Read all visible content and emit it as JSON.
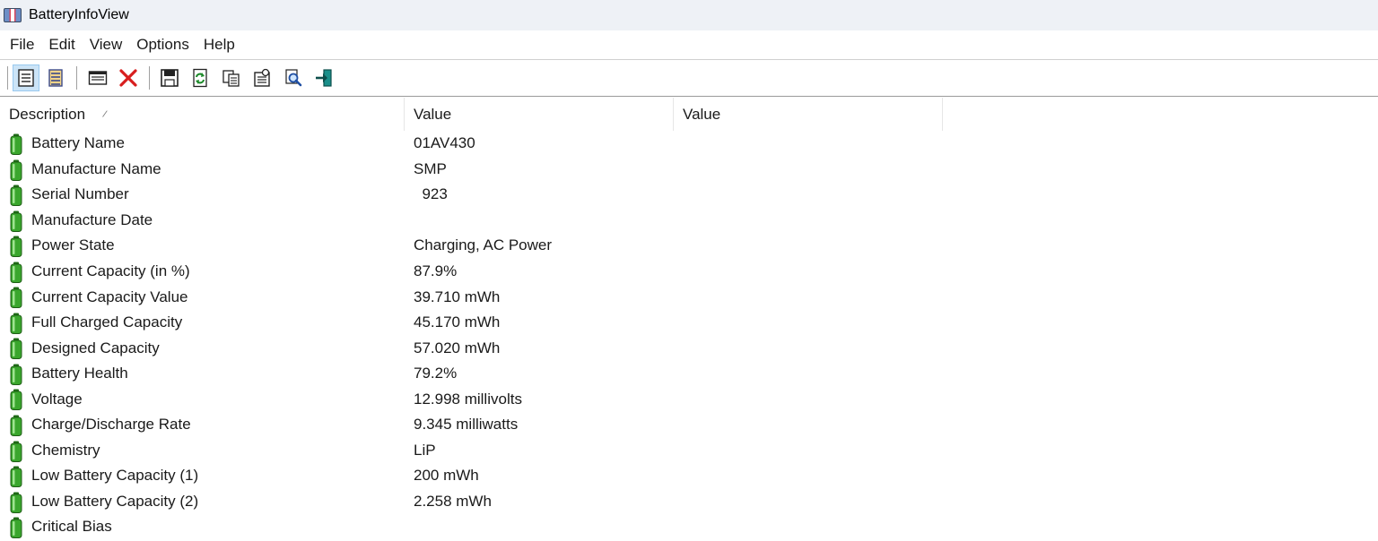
{
  "window": {
    "title": "BatteryInfoView",
    "icon": "battery-app-icon"
  },
  "menu": [
    "File",
    "Edit",
    "View",
    "Options",
    "Help"
  ],
  "toolbar": {
    "buttons": [
      {
        "icon": "properties-view-icon",
        "active": true
      },
      {
        "icon": "list-view-icon",
        "active": false
      },
      {
        "icon": "html-report-icon",
        "active": false
      },
      {
        "icon": "delete-icon",
        "active": false
      },
      {
        "icon": "save-icon",
        "active": false
      },
      {
        "icon": "refresh-icon",
        "active": false
      },
      {
        "icon": "copy-icon",
        "active": false
      },
      {
        "icon": "properties-icon",
        "active": false
      },
      {
        "icon": "find-icon",
        "active": false
      },
      {
        "icon": "exit-icon",
        "active": false
      }
    ]
  },
  "columns": [
    "Description",
    "Value",
    "Value"
  ],
  "rows": [
    {
      "description": "Battery Name",
      "value": "01AV430"
    },
    {
      "description": "Manufacture Name",
      "value": "SMP"
    },
    {
      "description": "Serial Number",
      "value": "  923"
    },
    {
      "description": "Manufacture Date",
      "value": ""
    },
    {
      "description": "Power State",
      "value": "Charging, AC Power"
    },
    {
      "description": "Current Capacity (in %)",
      "value": "87.9%"
    },
    {
      "description": "Current Capacity Value",
      "value": "39.710 mWh"
    },
    {
      "description": "Full Charged Capacity",
      "value": "45.170 mWh"
    },
    {
      "description": "Designed Capacity",
      "value": "57.020 mWh"
    },
    {
      "description": "Battery Health",
      "value": "79.2%"
    },
    {
      "description": "Voltage",
      "value": "12.998 millivolts"
    },
    {
      "description": "Charge/Discharge Rate",
      "value": "9.345 milliwatts"
    },
    {
      "description": "Chemistry",
      "value": "LiP"
    },
    {
      "description": "Low Battery Capacity (1)",
      "value": "200 mWh"
    },
    {
      "description": "Low Battery Capacity (2)",
      "value": "2.258 mWh"
    },
    {
      "description": "Critical Bias",
      "value": ""
    }
  ],
  "colors": {
    "battery_green": "#3aa62d",
    "active_button_bg": "#cce4f7",
    "delete_red": "#d81e1e"
  }
}
